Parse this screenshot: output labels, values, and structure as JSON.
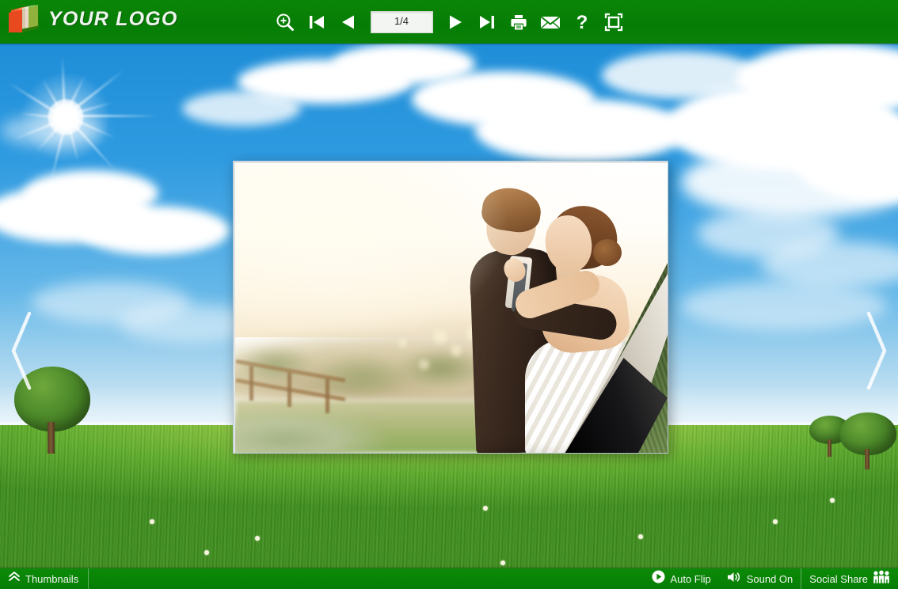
{
  "app": {
    "logo_text": "YOUR LOGO",
    "logo_icon": "book-folder-logo-icon",
    "brand_green": "#0a8006",
    "sky_blue": "#2e9ae0",
    "grass_green": "#5fae2c"
  },
  "toolbar": {
    "zoom_in_label": "Zoom In",
    "first_page_label": "First Page",
    "previous_page_label": "Previous Page",
    "page_value": "1/4",
    "page_placeholder": "1/4",
    "next_page_label": "Next Page",
    "last_page_label": "Last Page",
    "print_label": "Print",
    "email_label": "Email",
    "help_label": "Help",
    "fullscreen_label": "Full Screen",
    "icons": [
      "zoom-in-icon",
      "first-page-icon",
      "previous-page-icon",
      "next-page-icon",
      "last-page-icon",
      "printer-icon",
      "envelope-icon",
      "question-mark-icon",
      "fullscreen-icon"
    ]
  },
  "navigation": {
    "prev_arrow_label": "Previous",
    "next_arrow_label": "Next",
    "prev_icon": "chevron-left-icon",
    "next_icon": "chevron-right-icon"
  },
  "book": {
    "current_page": 1,
    "total_pages": 4,
    "page_content_description": "Wedding photo of a couple embracing at sunset",
    "corner_curl": true
  },
  "bottom_bar": {
    "thumbnails_label": "Thumbnails",
    "thumbnails_icon": "double-chevron-up-icon",
    "auto_flip_label": "Auto Flip",
    "auto_flip_icon": "play-circle-icon",
    "sound_label": "Sound On",
    "sound_icon": "speaker-on-icon",
    "social_share_label": "Social Share",
    "social_share_icon": "people-group-icon"
  }
}
